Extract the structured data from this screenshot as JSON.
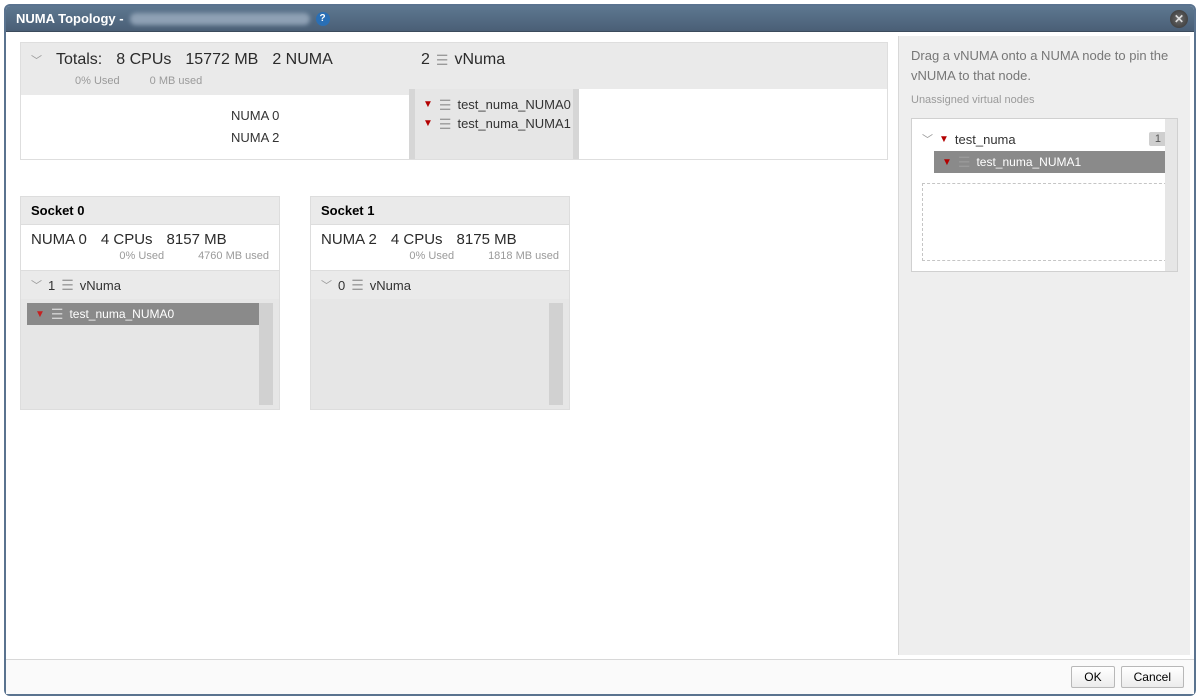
{
  "title_prefix": "NUMA Topology -",
  "totals": {
    "label": "Totals:",
    "cpus": "8 CPUs",
    "mem": "15772 MB",
    "numa": "2 NUMA",
    "pct_used": "0% Used",
    "mem_used": "0 MB used",
    "nodes": [
      "NUMA 0",
      "NUMA 2"
    ],
    "vnuma_count": "2",
    "vnuma_label": "vNuma",
    "vnuma_items": [
      "test_numa_NUMA0",
      "test_numa_NUMA1"
    ]
  },
  "sockets": [
    {
      "title": "Socket 0",
      "node": "NUMA 0",
      "cpus": "4 CPUs",
      "mem": "8157 MB",
      "pct_used": "0% Used",
      "mem_used": "4760 MB used",
      "vnuma_count": "1",
      "vnuma_label": "vNuma",
      "pinned": [
        "test_numa_NUMA0"
      ]
    },
    {
      "title": "Socket 1",
      "node": "NUMA 2",
      "cpus": "4 CPUs",
      "mem": "8175 MB",
      "pct_used": "0% Used",
      "mem_used": "1818 MB used",
      "vnuma_count": "0",
      "vnuma_label": "vNuma",
      "pinned": []
    }
  ],
  "side": {
    "hint": "Drag a vNUMA onto a NUMA node to pin the vNUMA to that node.",
    "subtitle": "Unassigned virtual nodes",
    "tree_root": "test_numa",
    "tree_badge": "1",
    "tree_child": "test_numa_NUMA1"
  },
  "buttons": {
    "ok": "OK",
    "cancel": "Cancel"
  }
}
